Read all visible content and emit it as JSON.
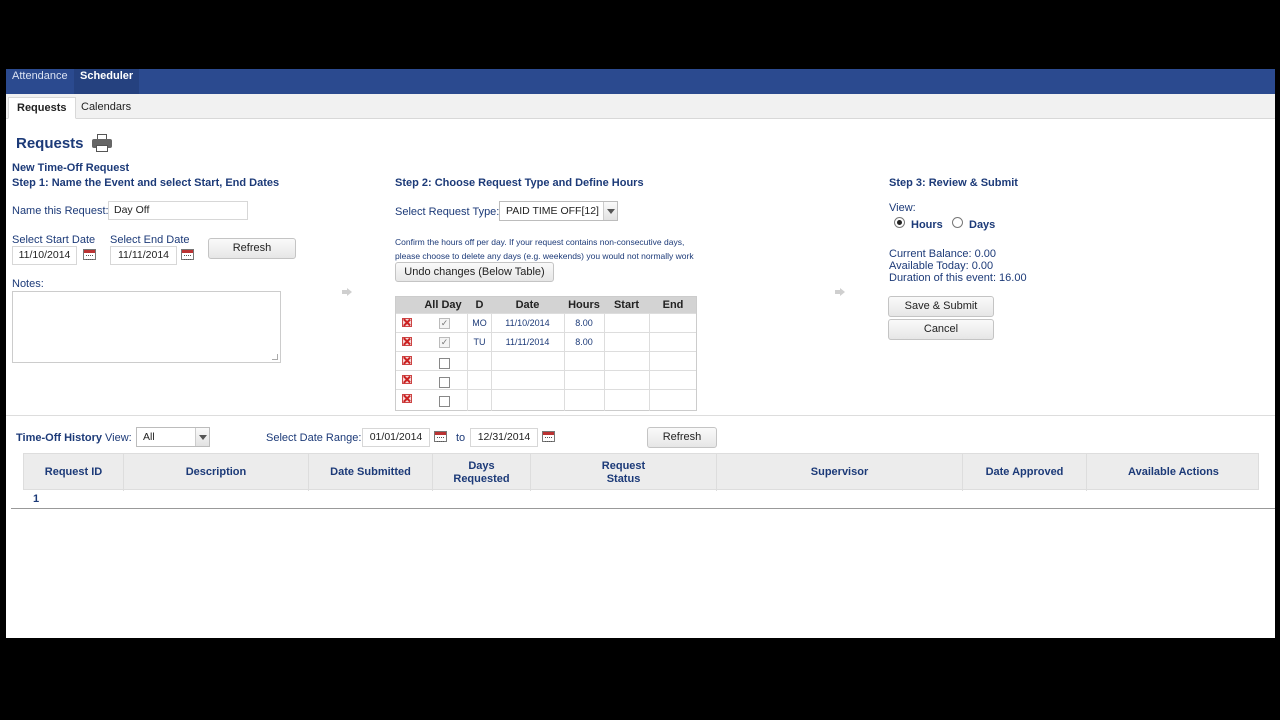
{
  "nav": {
    "tabs": [
      "Attendance",
      "Scheduler"
    ],
    "subtabs": [
      "Requests",
      "Calendars"
    ]
  },
  "page": {
    "title": "Requests",
    "section_title": "New Time-Off Request"
  },
  "step1": {
    "title": "Step 1: Name the Event and select Start, End Dates",
    "name_label": "Name this Request:",
    "name_value": "Day Off",
    "start_label": "Select Start Date",
    "start_value": "11/10/2014",
    "end_label": "Select End Date",
    "end_value": "11/11/2014",
    "refresh": "Refresh",
    "notes_label": "Notes:",
    "notes_value": ""
  },
  "step2": {
    "title": "Step 2: Choose Request Type and Define Hours",
    "type_label": "Select Request Type:",
    "type_value": "PAID TIME OFF[12]",
    "instructions_line1": "Confirm the hours off per day. If your request contains non-consecutive days,",
    "instructions_line2": "please choose to delete any days (e.g. weekends) you would not normally work",
    "undo": "Undo changes (Below Table)",
    "columns": [
      "All Day",
      "D",
      "Date",
      "Hours",
      "Start",
      "End"
    ],
    "rows": [
      {
        "checked": true,
        "day": "MO",
        "date": "11/10/2014",
        "hours": "8.00",
        "start": "",
        "end": ""
      },
      {
        "checked": true,
        "day": "TU",
        "date": "11/11/2014",
        "hours": "8.00",
        "start": "",
        "end": ""
      },
      {
        "checked": false,
        "day": "",
        "date": "",
        "hours": "",
        "start": "",
        "end": ""
      },
      {
        "checked": false,
        "day": "",
        "date": "",
        "hours": "",
        "start": "",
        "end": ""
      },
      {
        "checked": false,
        "day": "",
        "date": "",
        "hours": "",
        "start": "",
        "end": ""
      }
    ]
  },
  "step3": {
    "title": "Step 3: Review & Submit",
    "view_label": "View:",
    "view_hours": "Hours",
    "view_days": "Days",
    "balance": "Current Balance: 0.00",
    "available": "Available Today: 0.00",
    "duration": "Duration of this event: 16.00",
    "save": "Save & Submit",
    "cancel": "Cancel"
  },
  "history": {
    "title": "Time-Off History",
    "view_label": "View:",
    "view_value": "All",
    "range_label": "Select Date Range:",
    "from": "01/01/2014",
    "to_label": "to",
    "to": "12/31/2014",
    "refresh": "Refresh",
    "columns": [
      "Request ID",
      "Description",
      "Date Submitted",
      "Days Requested",
      "Request Status",
      "Supervisor",
      "Date Approved",
      "Available Actions"
    ],
    "pages": [
      "1"
    ]
  },
  "icons": {
    "print": "printer-icon",
    "calendar": "calendar-icon",
    "delete": "delete-row-icon",
    "next": "arrow-right-icon"
  }
}
